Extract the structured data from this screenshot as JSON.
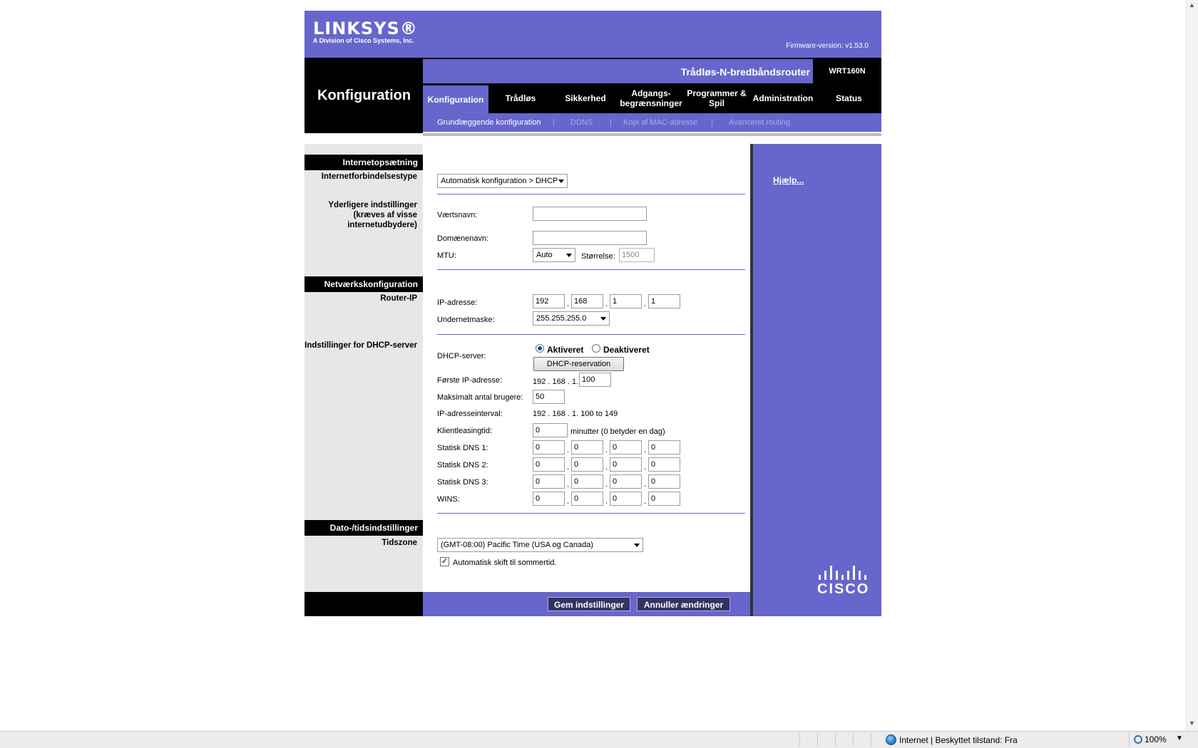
{
  "header": {
    "logo_name": "LINKSYS®",
    "logo_sub": "A Division of Cisco Systems, Inc.",
    "firmware": "Firmware-version: v1.53.0",
    "product_name": "Trådløs-N-bredbåndsrouter",
    "model": "WRT160N",
    "page_title": "Konfiguration"
  },
  "tabs": [
    {
      "label": "Konfiguration",
      "active": true
    },
    {
      "label": "Trådløs"
    },
    {
      "label": "Sikkerhed"
    },
    {
      "label": "Adgangs-\nbegrænsninger"
    },
    {
      "label": "Programmer &\nSpil"
    },
    {
      "label": "Administration"
    },
    {
      "label": "Status"
    }
  ],
  "subtabs": [
    {
      "label": "Grundlæggende konfiguration",
      "active": true
    },
    {
      "label": "DDNS"
    },
    {
      "label": "Kopi af MAC-adresse"
    },
    {
      "label": "Avanceret routing"
    }
  ],
  "subtab_separator": "|",
  "sections": {
    "internet": {
      "head": "Internetopsætning",
      "sub1": "Internetforbindelsestype",
      "sub2": "Yderligere indstillinger (kræves af visse internetudbydere)"
    },
    "network": {
      "head": "Netværkskonfiguration",
      "sub1": "Router-IP",
      "sub2": "Indstillinger for DHCP-server"
    },
    "time": {
      "head": "Dato-/tidsindstillinger",
      "sub1": "Tidszone"
    }
  },
  "form": {
    "connection_type": "Automatisk konfiguration > DHCP",
    "hostname_label": "Værtsnavn:",
    "hostname_value": "",
    "domain_label": "Domænenavn:",
    "domain_value": "",
    "mtu_label": "MTU:",
    "mtu_value": "Auto",
    "size_label": "Størrelse:",
    "size_value": "1500",
    "ip_label": "IP-adresse:",
    "ip": [
      "192",
      "168",
      "1",
      "1"
    ],
    "subnet_label": "Undernetmaske:",
    "subnet_value": "255.255.255.0",
    "dhcp_label": "DHCP-server:",
    "dhcp_enabled": "Aktiveret",
    "dhcp_disabled": "Deaktiveret",
    "dhcp_reservation": "DHCP-reservation",
    "first_ip_label": "Første IP-adresse:",
    "first_ip_prefix": "192 . 168 . 1.",
    "first_ip_value": "100",
    "max_users_label": "Maksimalt antal brugere:",
    "max_users_value": "50",
    "range_label": "IP-adresseinterval:",
    "range_value": "192 . 168 . 1. 100 to 149",
    "lease_label": "Klientleasingtid:",
    "lease_value": "0",
    "lease_suffix": "minutter (0 betyder en dag)",
    "dns1_label": "Statisk DNS 1:",
    "dns2_label": "Statisk DNS 2:",
    "dns3_label": "Statisk DNS 3:",
    "wins_label": "WINS:",
    "dns1": [
      "0",
      "0",
      "0",
      "0"
    ],
    "dns2": [
      "0",
      "0",
      "0",
      "0"
    ],
    "dns3": [
      "0",
      "0",
      "0",
      "0"
    ],
    "wins": [
      "0",
      "0",
      "0",
      "0"
    ],
    "ip_dot": ".",
    "timezone_value": "(GMT-08:00) Pacific Time (USA og Canada)",
    "dst_label": "Automatisk skift til sommertid.",
    "dst_checked": true
  },
  "footer": {
    "save": "Gem indstillinger",
    "cancel": "Annuller ændringer"
  },
  "help": {
    "link": "Hjælp..."
  },
  "brand": {
    "cisco": "CISCO"
  },
  "statusbar": {
    "zone": "Internet | Beskyttet tilstand: Fra",
    "zoom": "100%"
  },
  "colors": {
    "brand_purple": "#6666cc",
    "black": "#000000",
    "side_gray": "#e7e7e7"
  }
}
